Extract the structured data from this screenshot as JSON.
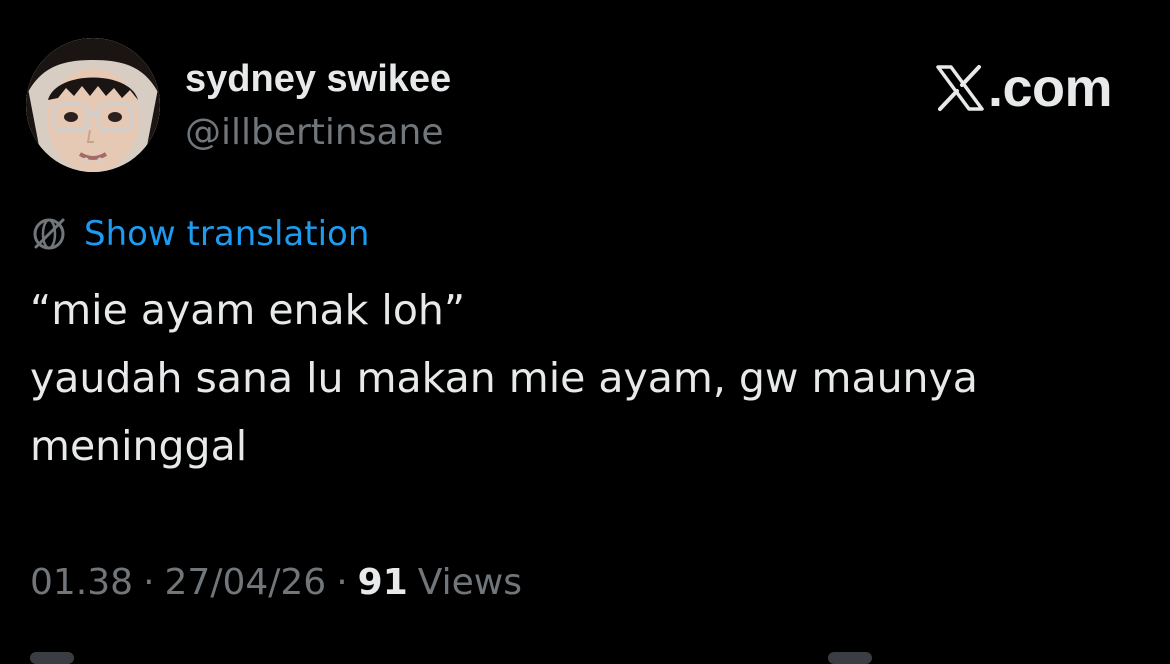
{
  "author": {
    "display_name": "sydney swikee",
    "handle": "@illbertinsane",
    "avatar_icon": "profile-photo"
  },
  "brand": {
    "logo_icon": "x-logo-icon",
    "text": ".com"
  },
  "translation": {
    "icon": "globe-icon",
    "label": "Show translation"
  },
  "tweet": {
    "lines": [
      "“mie ayam enak loh”",
      "yaudah sana lu makan mie ayam, gw maunya",
      "meninggal"
    ]
  },
  "meta": {
    "time": "01.38",
    "date": "27/04/26",
    "views_count": "91",
    "views_label": "Views",
    "separator": "·"
  },
  "colors": {
    "background": "#000000",
    "text_primary": "#e7e9ea",
    "text_secondary": "#71767b",
    "link": "#1d9bf0"
  }
}
